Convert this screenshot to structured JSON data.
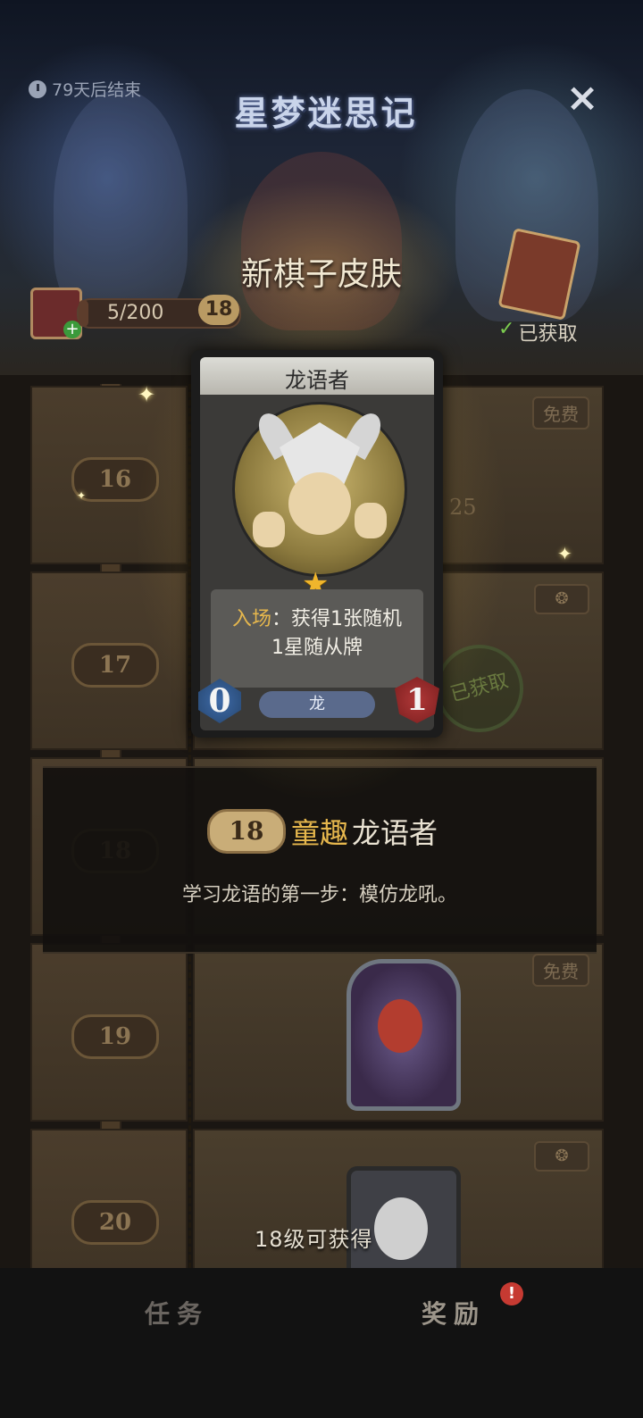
{
  "header": {
    "timer": "79天后结束",
    "game_title": "星梦迷思记",
    "close_icon": "×",
    "popup_title": "新棋子皮肤",
    "progress": {
      "text": "5/200",
      "level": "18",
      "fraction": 0.025
    },
    "obtained": "已获取",
    "check_icon": "✓"
  },
  "rows": [
    {
      "level": "16",
      "tag": "免费",
      "ghost_value": "25"
    },
    {
      "level": "17",
      "premium_icon": "❂",
      "stamp": "已获取"
    },
    {
      "level": "18"
    },
    {
      "level": "19",
      "tag": "免费"
    },
    {
      "level": "20",
      "premium_icon": "❂"
    }
  ],
  "info": {
    "level": "18",
    "quality": "童趣",
    "name": "龙语者",
    "description": "学习龙语的第一步：模仿龙吼。"
  },
  "lock_hint": "18级可获得",
  "card": {
    "name": "龙语者",
    "star": "★",
    "keyword": "入场",
    "text_line1": "：获得1张随机",
    "text_line2": "1星随从牌",
    "cost": "0",
    "tribe": "龙",
    "attack": "1"
  },
  "tabs": {
    "tasks": "任务",
    "rewards": "奖励",
    "notify": "!"
  },
  "colors": {
    "accent_gold": "#e6b74d",
    "notify_red": "#c63a32",
    "check_green": "#7ccc4f"
  }
}
